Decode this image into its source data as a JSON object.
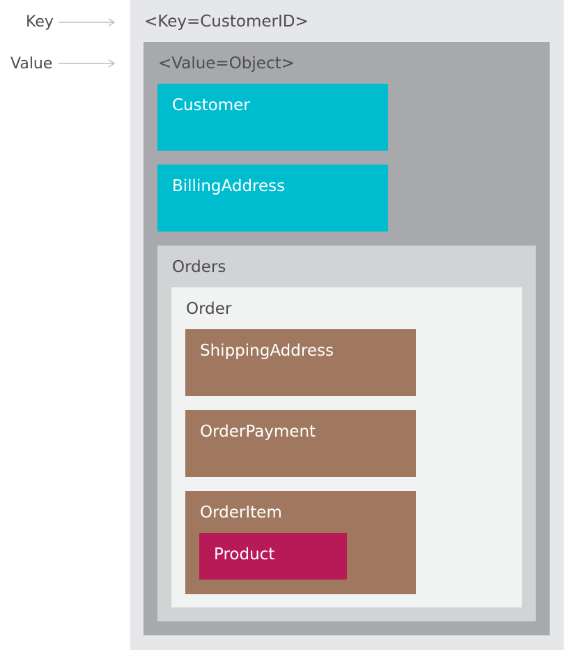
{
  "legend": {
    "key_label": "Key",
    "value_label": "Value"
  },
  "diagram": {
    "key_title": "<Key=CustomerID>",
    "value_title": "<Value=Object>",
    "customer": "Customer",
    "billing_address": "BillingAddress",
    "orders": "Orders",
    "order": "Order",
    "shipping_address": "ShippingAddress",
    "order_payment": "OrderPayment",
    "order_item": "OrderItem",
    "product": "Product"
  },
  "colors": {
    "outer_background": "#e6e7e8",
    "value_background": "#a7a9ac",
    "entity_teal": "#00bccf",
    "orders_background": "#d1d3d4",
    "order_background": "#f1f2f2",
    "order_entity_brown": "#a07860",
    "product_magenta": "#b71a56",
    "label_gray": "#4d4d4f",
    "arrow_gray": "#bcbec0"
  }
}
